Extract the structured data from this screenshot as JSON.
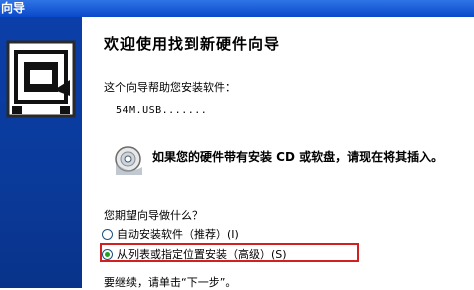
{
  "window": {
    "title": "向导"
  },
  "main": {
    "heading": "欢迎使用找到新硬件向导",
    "intro": "这个向导帮助您安装软件：",
    "device_name": "54M.USB.......",
    "cd_prompt": "如果您的硬件带有安装 CD 或软盘，请现在将其插入。",
    "question": "您期望向导做什么？",
    "options": [
      {
        "label": "自动安装软件（推荐）(I)",
        "selected": false
      },
      {
        "label": "从列表或指定位置安装（高级）(S)",
        "selected": true
      }
    ],
    "footer": "要继续，请单击“下一步”。"
  },
  "colors": {
    "sidebar": "#0b3ea8",
    "title_bar": "#0a49c9",
    "highlight": "#d21f1f",
    "radio_dot": "#1ba51b"
  },
  "icons": [
    "hardware-wizard-icon",
    "cd-icon",
    "radio-icon"
  ]
}
